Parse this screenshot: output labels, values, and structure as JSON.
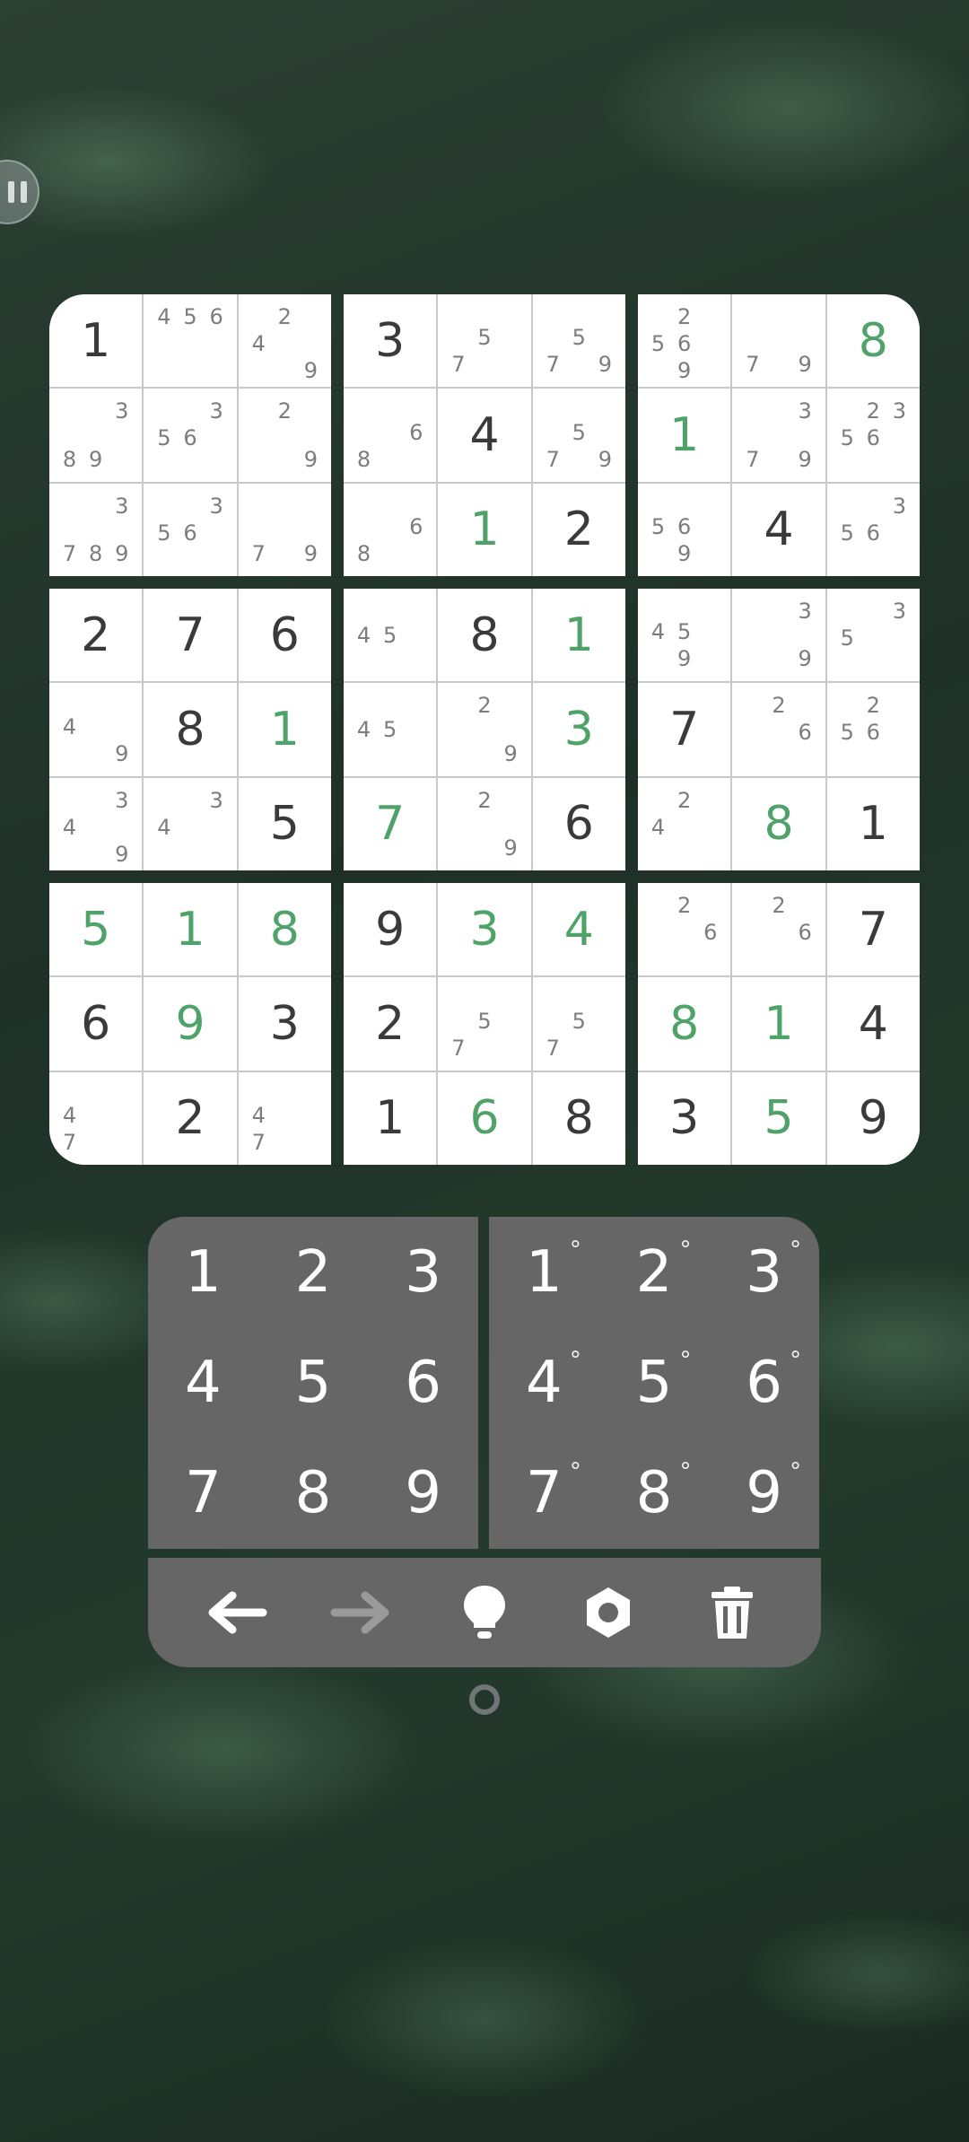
{
  "pause": {
    "icon": "pause-icon"
  },
  "board": {
    "boxes": [
      [
        {
          "v": "1",
          "t": "given"
        },
        {
          "n": [
            "4",
            "5",
            "6",
            "",
            "",
            "",
            "",
            "",
            ""
          ]
        },
        {
          "n": [
            "",
            "2",
            "",
            "4",
            "",
            "",
            "",
            "",
            "9"
          ]
        },
        {
          "n": [
            "",
            "",
            "3",
            "",
            "",
            "",
            "8",
            "9",
            ""
          ]
        },
        {
          "n": [
            "",
            "",
            "3",
            "5",
            "6",
            "",
            "",
            "",
            ""
          ]
        },
        {
          "n": [
            "",
            "2",
            "",
            "",
            "",
            "",
            "",
            "",
            "9"
          ]
        },
        {
          "n": [
            "",
            "",
            "3",
            "",
            "",
            "",
            "7",
            "8",
            "9"
          ]
        },
        {
          "n": [
            "",
            "",
            "3",
            "5",
            "6",
            "",
            "",
            "",
            ""
          ]
        },
        {
          "n": [
            "",
            "",
            "",
            "",
            "",
            "",
            "7",
            "",
            "9"
          ]
        }
      ],
      [
        {
          "v": "3",
          "t": "given"
        },
        {
          "n": [
            "",
            "",
            "",
            "",
            "5",
            "",
            "7",
            "",
            ""
          ]
        },
        {
          "n": [
            "",
            "",
            "",
            "",
            "5",
            "",
            "7",
            "",
            "9"
          ]
        },
        {
          "n": [
            "",
            "",
            "",
            "",
            "",
            "6",
            "8",
            "",
            ""
          ]
        },
        {
          "v": "4",
          "t": "given"
        },
        {
          "n": [
            "",
            "",
            "",
            "",
            "5",
            "",
            "7",
            "",
            "9"
          ]
        },
        {
          "n": [
            "",
            "",
            "",
            "",
            "",
            "6",
            "8",
            "",
            ""
          ]
        },
        {
          "v": "1",
          "t": "user"
        },
        {
          "v": "2",
          "t": "given"
        }
      ],
      [
        {
          "n": [
            "",
            "2",
            "",
            "5",
            "6",
            "",
            "",
            "9",
            ""
          ]
        },
        {
          "n": [
            "",
            "",
            "",
            "",
            "",
            "",
            "7",
            "",
            "9"
          ]
        },
        {
          "v": "8",
          "t": "user"
        },
        {
          "v": "1",
          "t": "user"
        },
        {
          "n": [
            "",
            "",
            "3",
            "",
            "",
            "",
            "7",
            "",
            "9"
          ]
        },
        {
          "n": [
            "",
            "2",
            "3",
            "5",
            "6",
            "",
            "",
            "",
            ""
          ]
        },
        {
          "n": [
            "",
            "",
            "",
            "5",
            "6",
            "",
            "",
            "9",
            ""
          ]
        },
        {
          "v": "4",
          "t": "given"
        },
        {
          "n": [
            "",
            "",
            "3",
            "5",
            "6",
            "",
            "",
            "",
            ""
          ]
        }
      ],
      [
        {
          "v": "2",
          "t": "given"
        },
        {
          "v": "7",
          "t": "given"
        },
        {
          "v": "6",
          "t": "given"
        },
        {
          "n": [
            "",
            "",
            "",
            "4",
            "",
            "",
            "",
            "",
            "9"
          ]
        },
        {
          "v": "8",
          "t": "given"
        },
        {
          "v": "1",
          "t": "user"
        },
        {
          "n": [
            "",
            "",
            "3",
            "4",
            "",
            "",
            "",
            "",
            "9"
          ]
        },
        {
          "n": [
            "",
            "",
            "3",
            "4",
            "",
            "",
            "",
            "",
            ""
          ]
        },
        {
          "v": "5",
          "t": "given"
        }
      ],
      [
        {
          "n": [
            "",
            "",
            "",
            "4",
            "5",
            "",
            "",
            "",
            ""
          ]
        },
        {
          "v": "8",
          "t": "given"
        },
        {
          "v": "1",
          "t": "user"
        },
        {
          "n": [
            "",
            "",
            "",
            "4",
            "5",
            "",
            "",
            "",
            ""
          ]
        },
        {
          "n": [
            "",
            "2",
            "",
            "",
            "",
            "",
            "",
            "",
            "9"
          ]
        },
        {
          "v": "3",
          "t": "user"
        },
        {
          "v": "7",
          "t": "user"
        },
        {
          "n": [
            "",
            "2",
            "",
            "",
            "",
            "",
            "",
            "",
            "9"
          ]
        },
        {
          "v": "6",
          "t": "given"
        }
      ],
      [
        {
          "n": [
            "",
            "",
            "",
            "4",
            "5",
            "",
            "",
            "9",
            ""
          ]
        },
        {
          "n": [
            "",
            "",
            "3",
            "",
            "",
            "",
            "",
            "",
            "9"
          ]
        },
        {
          "n": [
            "",
            "",
            "3",
            "5",
            "",
            "",
            "",
            "",
            ""
          ]
        },
        {
          "v": "7",
          "t": "given"
        },
        {
          "n": [
            "",
            "2",
            "",
            "",
            "",
            "6",
            "",
            "",
            ""
          ]
        },
        {
          "n": [
            "",
            "2",
            "",
            "5",
            "6",
            "",
            "",
            "",
            ""
          ]
        },
        {
          "n": [
            "",
            "2",
            "",
            "4",
            "",
            "",
            "",
            "",
            ""
          ]
        },
        {
          "v": "8",
          "t": "user"
        },
        {
          "v": "1",
          "t": "given"
        }
      ],
      [
        {
          "v": "5",
          "t": "user"
        },
        {
          "v": "1",
          "t": "user"
        },
        {
          "v": "8",
          "t": "user"
        },
        {
          "v": "6",
          "t": "given"
        },
        {
          "v": "9",
          "t": "user"
        },
        {
          "v": "3",
          "t": "given"
        },
        {
          "n": [
            "",
            "",
            "",
            "4",
            "",
            "",
            "7",
            "",
            ""
          ]
        },
        {
          "v": "2",
          "t": "given"
        },
        {
          "n": [
            "",
            "",
            "",
            "4",
            "",
            "",
            "7",
            "",
            ""
          ]
        }
      ],
      [
        {
          "v": "9",
          "t": "given"
        },
        {
          "v": "3",
          "t": "user"
        },
        {
          "v": "4",
          "t": "user"
        },
        {
          "v": "2",
          "t": "given"
        },
        {
          "n": [
            "",
            "",
            "",
            "",
            "5",
            "",
            "7",
            "",
            ""
          ]
        },
        {
          "n": [
            "",
            "",
            "",
            "",
            "5",
            "",
            "7",
            "",
            ""
          ]
        },
        {
          "v": "1",
          "t": "given"
        },
        {
          "v": "6",
          "t": "user"
        },
        {
          "v": "8",
          "t": "given"
        }
      ],
      [
        {
          "n": [
            "",
            "2",
            "",
            "",
            "",
            "6",
            "",
            "",
            ""
          ]
        },
        {
          "n": [
            "",
            "2",
            "",
            "",
            "",
            "6",
            "",
            "",
            ""
          ]
        },
        {
          "v": "7",
          "t": "given"
        },
        {
          "v": "8",
          "t": "user"
        },
        {
          "v": "1",
          "t": "user"
        },
        {
          "v": "4",
          "t": "given"
        },
        {
          "v": "3",
          "t": "given"
        },
        {
          "v": "5",
          "t": "user"
        },
        {
          "v": "9",
          "t": "given"
        }
      ]
    ]
  },
  "keypad": {
    "digits": [
      "1",
      "2",
      "3",
      "4",
      "5",
      "6",
      "7",
      "8",
      "9"
    ],
    "notes": [
      "1",
      "2",
      "3",
      "4",
      "5",
      "6",
      "7",
      "8",
      "9"
    ],
    "notes_mark": "°"
  },
  "toolbar": {
    "items": [
      {
        "name": "undo",
        "icon": "arrow-left-icon",
        "color": "#ffffff"
      },
      {
        "name": "redo",
        "icon": "arrow-right-icon",
        "color": "#9a9a9a"
      },
      {
        "name": "hint",
        "icon": "lightbulb-icon",
        "color": "#ffffff"
      },
      {
        "name": "settings",
        "icon": "gear-icon",
        "color": "#ffffff"
      },
      {
        "name": "clear",
        "icon": "trash-icon",
        "color": "#ffffff"
      }
    ]
  },
  "colors": {
    "user_digit": "#4fa368",
    "given_digit": "#3a3a3a",
    "note_digit": "#7d7d7d",
    "pad": "#666666"
  }
}
